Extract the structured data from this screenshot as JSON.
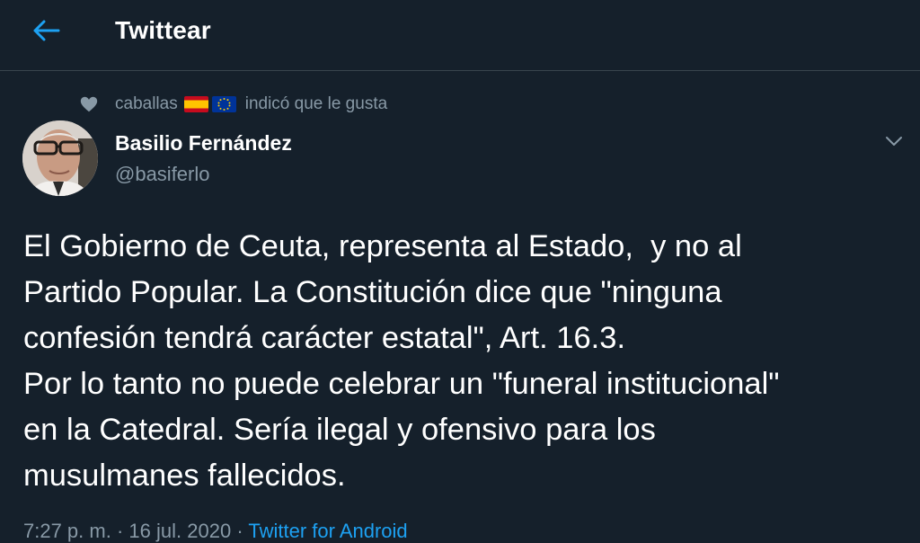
{
  "header": {
    "title": "Twittear",
    "back_icon": "arrow-left-icon"
  },
  "social_context": {
    "icon": "heart-icon",
    "user": "caballas",
    "flags": [
      "spain-flag",
      "eu-flag"
    ],
    "action": "indicó que le gusta"
  },
  "tweet": {
    "author_name": "Basilio Fernández",
    "author_handle": "@basiferlo",
    "text": "El Gobierno de Ceuta, representa al Estado,  y no al\nPartido Popular. La Constitución dice que \"ninguna\nconfesión tendrá carácter estatal\", Art. 16.3.\nPor lo tanto no puede celebrar un \"funeral institucional\"\nen la Catedral. Sería ilegal y ofensivo para los\nmusulmanes fallecidos.",
    "time": "7:27 p. m.",
    "date": "16 jul. 2020",
    "separator": "·",
    "source": "Twitter for Android"
  },
  "colors": {
    "background": "#15202b",
    "secondary_text": "#8899a6",
    "accent": "#1da1f2",
    "divider": "#38444d"
  }
}
